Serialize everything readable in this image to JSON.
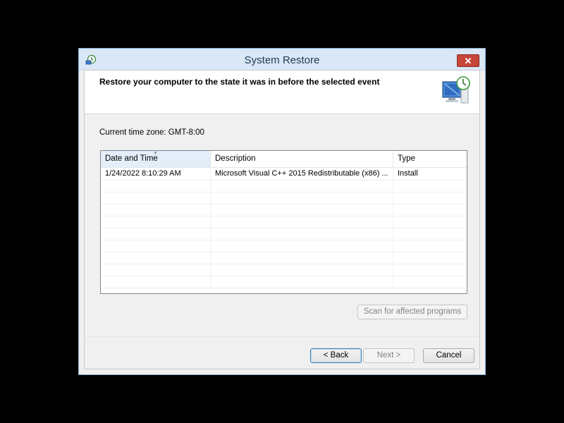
{
  "window": {
    "title": "System Restore",
    "close_glyph": "✕"
  },
  "header": {
    "instruction": "Restore your computer to the state it was in before the selected event",
    "icon": "system-restore-monitor-icon"
  },
  "timezone": "Current time zone: GMT-8:00",
  "list": {
    "columns": [
      "Date and Time",
      "Description",
      "Type"
    ],
    "sorted_column": "Date and Time",
    "rows": [
      {
        "date": "1/24/2022 8:10:29 AM",
        "description": "Microsoft Visual C++ 2015 Redistributable (x86) ...",
        "type": "Install"
      }
    ]
  },
  "buttons": {
    "scan": "Scan for affected programs",
    "back": "< Back",
    "next": "Next >",
    "cancel": "Cancel"
  },
  "colors": {
    "close_button": "#c7463a",
    "titlebar": "#d9e7f6",
    "sorted_header": "#e4eef9"
  }
}
